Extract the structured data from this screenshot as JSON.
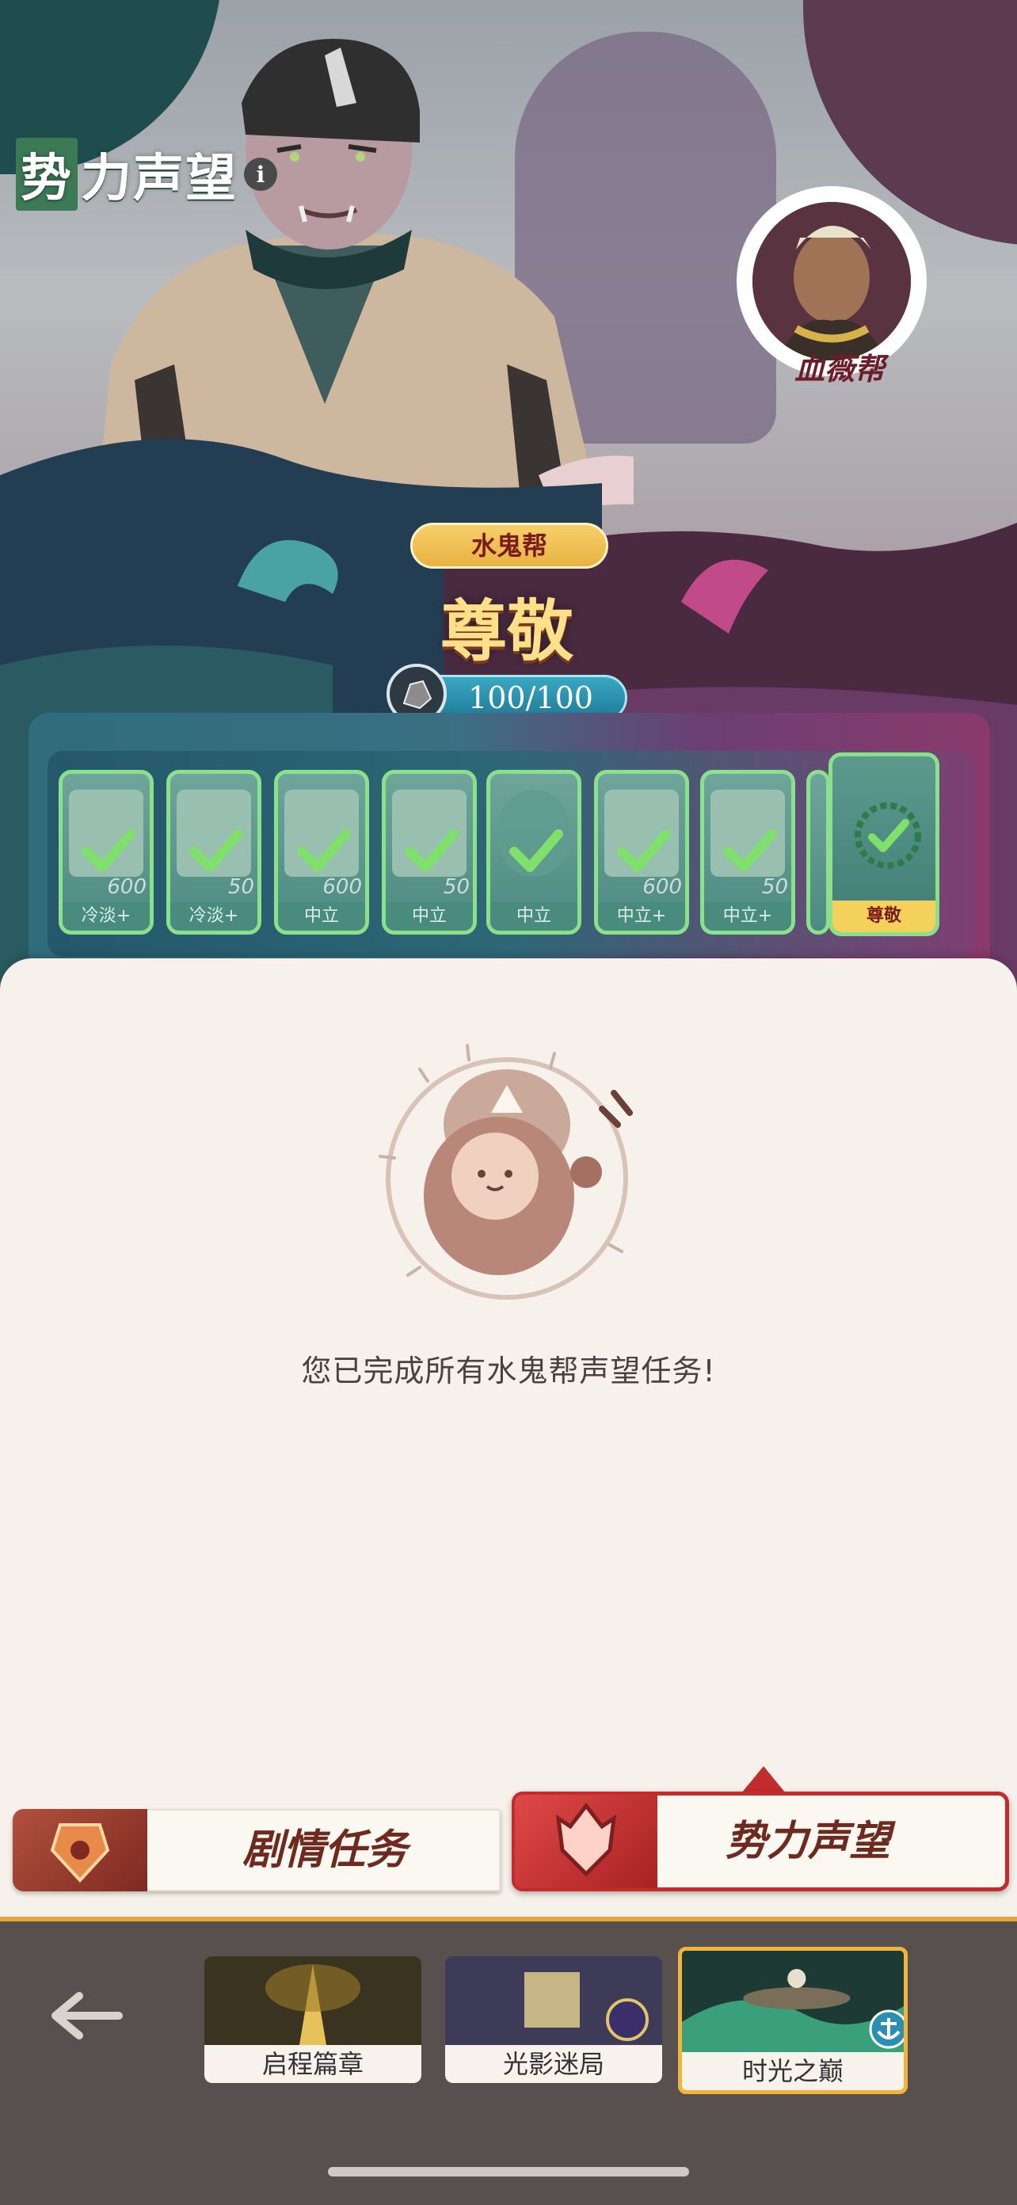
{
  "header": {
    "title_chars": [
      "势",
      "力声望"
    ],
    "info_glyph": "i"
  },
  "rival": {
    "label": "血薇帮"
  },
  "faction": {
    "name": "水鬼帮",
    "level": "尊敬",
    "progress": "100/100"
  },
  "reward_track": {
    "cards": [
      {
        "label": "冷淡+",
        "value": "600",
        "completed": true
      },
      {
        "label": "冷淡+",
        "value": "50",
        "completed": true
      },
      {
        "label": "中立",
        "value": "600",
        "completed": true
      },
      {
        "label": "中立",
        "value": "50",
        "completed": true
      },
      {
        "label": "中立",
        "value": "",
        "completed": true
      },
      {
        "label": "中立+",
        "value": "600",
        "completed": true
      },
      {
        "label": "中立+",
        "value": "50",
        "completed": true
      }
    ],
    "current": {
      "label": "尊敬",
      "completed": true
    }
  },
  "content": {
    "message": "您已完成所有水鬼帮声望任务!"
  },
  "tabs": {
    "story": "剧情任务",
    "reputation": "势力声望",
    "active": "reputation"
  },
  "chapters": [
    {
      "label": "启程篇章",
      "active": false
    },
    {
      "label": "光影迷局",
      "active": false
    },
    {
      "label": "时光之巅",
      "active": true
    }
  ],
  "icons": [
    "info-icon",
    "check-icon",
    "back-arrow-icon",
    "anchor-icon",
    "tab-story-icon",
    "tab-reputation-icon"
  ],
  "colors": {
    "accent_red": "#c22c2c",
    "accent_gold": "#f0b53a",
    "check_green": "#8be08b"
  }
}
